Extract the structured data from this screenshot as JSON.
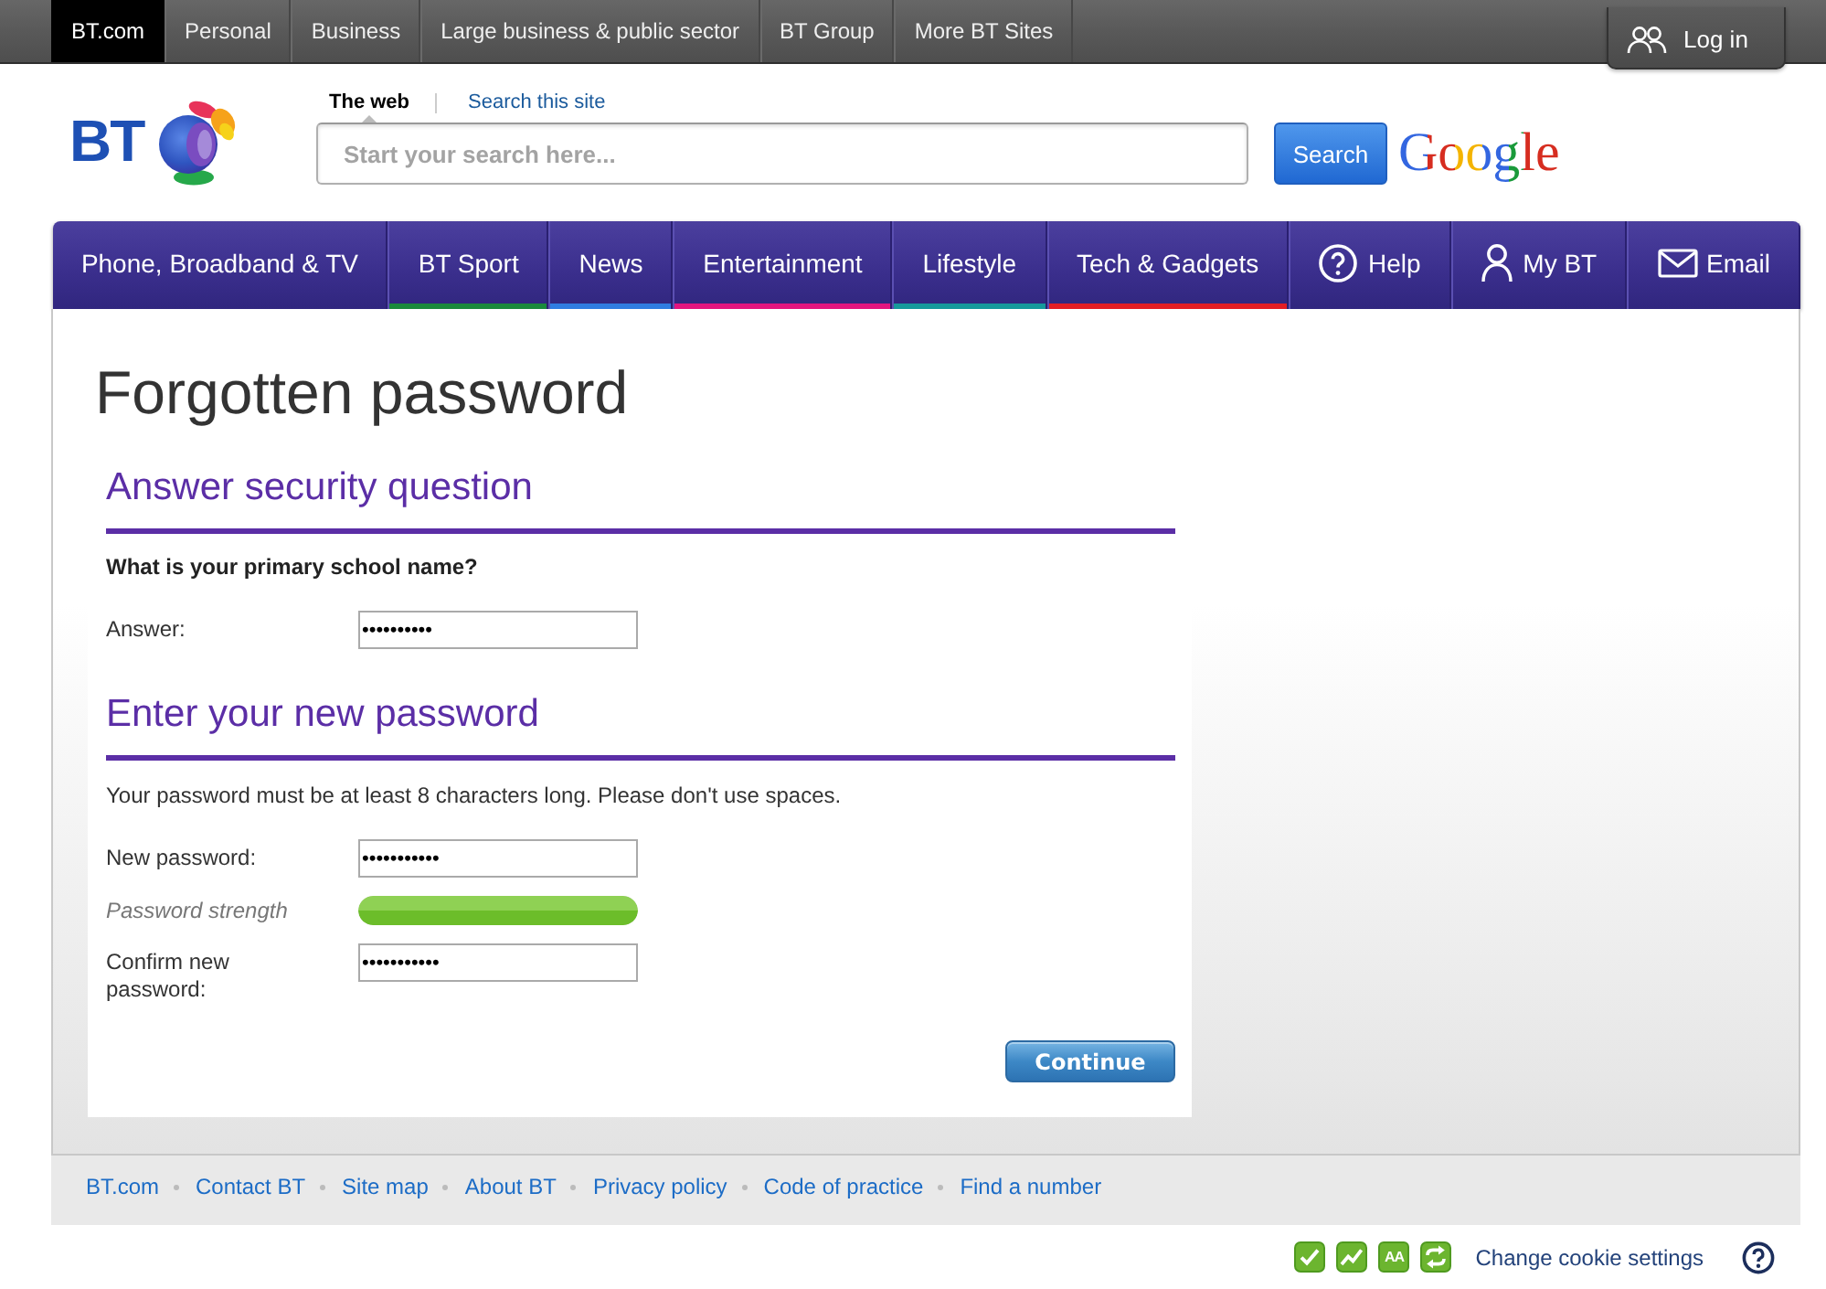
{
  "top_bar": {
    "tabs": [
      {
        "label": "BT.com",
        "selected": true
      },
      {
        "label": "Personal",
        "selected": false
      },
      {
        "label": "Business",
        "selected": false
      },
      {
        "label": "Large business & public sector",
        "selected": false
      },
      {
        "label": "BT Group",
        "selected": false
      },
      {
        "label": "More BT Sites",
        "selected": false
      }
    ],
    "login": "Log in"
  },
  "header": {
    "logo": "BT",
    "search": {
      "tabs": [
        {
          "label": "The web",
          "selected": true
        },
        {
          "label": "Search this site",
          "selected": false
        }
      ],
      "placeholder": "Start your search here...",
      "button": "Search",
      "provider": "Google"
    }
  },
  "nav": [
    {
      "label": "Phone, Broadband & TV",
      "kind": "link"
    },
    {
      "label": "BT Sport",
      "kind": "link",
      "color": "#1a8a3c"
    },
    {
      "label": "News",
      "kind": "link",
      "color": "#2f7de1"
    },
    {
      "label": "Entertainment",
      "kind": "link",
      "color": "#e3157f"
    },
    {
      "label": "Lifestyle",
      "kind": "link",
      "color": "#16999b"
    },
    {
      "label": "Tech & Gadgets",
      "kind": "link",
      "color": "#e31e24"
    },
    {
      "label": "Help",
      "kind": "help"
    },
    {
      "label": "My BT",
      "kind": "account"
    },
    {
      "label": "Email",
      "kind": "email"
    }
  ],
  "page": {
    "title": "Forgotten password",
    "sections": [
      {
        "heading": "Answer security question",
        "question": "What is your primary school name?",
        "fields": [
          {
            "kind": "input",
            "label": "Answer:",
            "value": "••••••••••"
          }
        ]
      },
      {
        "heading": "Enter your new password",
        "note": "Your password must be at least 8 characters long. Please don't use spaces.",
        "fields": [
          {
            "kind": "input",
            "label": "New password:",
            "value": "•••••••••••"
          },
          {
            "kind": "meter",
            "label": "Password strength",
            "level": 1
          },
          {
            "kind": "input",
            "label": "Confirm new password:",
            "value": "•••••••••••"
          }
        ]
      }
    ],
    "button": "Continue"
  },
  "footer": {
    "links": [
      "BT.com",
      "Contact BT",
      "Site map",
      "About BT",
      "Privacy policy",
      "Code of practice",
      "Find a number"
    ]
  },
  "cookie_bar": {
    "icons": [
      {
        "kind": "tick"
      },
      {
        "kind": "chart"
      },
      {
        "kind": "text",
        "label": "AA"
      },
      {
        "kind": "swap"
      }
    ],
    "link": "Change cookie settings"
  }
}
